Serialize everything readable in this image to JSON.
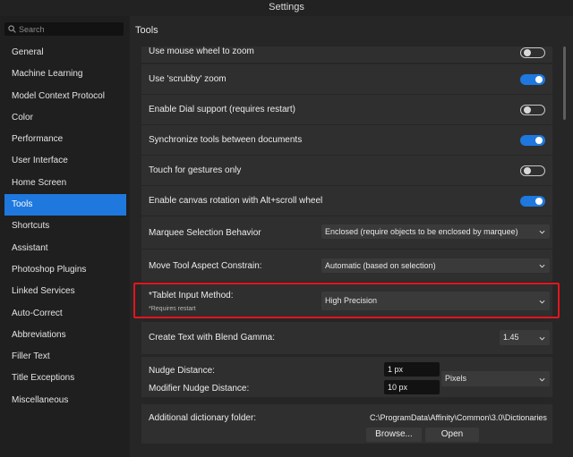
{
  "window": {
    "title": "Settings"
  },
  "search": {
    "placeholder": "Search"
  },
  "sidebar": {
    "items": [
      {
        "label": "General",
        "active": false
      },
      {
        "label": "Machine Learning",
        "active": false
      },
      {
        "label": "Model Context Protocol",
        "active": false
      },
      {
        "label": "Color",
        "active": false
      },
      {
        "label": "Performance",
        "active": false
      },
      {
        "label": "User Interface",
        "active": false
      },
      {
        "label": "Home Screen",
        "active": false
      },
      {
        "label": "Tools",
        "active": true
      },
      {
        "label": "Shortcuts",
        "active": false
      },
      {
        "label": "Assistant",
        "active": false
      },
      {
        "label": "Photoshop Plugins",
        "active": false
      },
      {
        "label": "Linked Services",
        "active": false
      },
      {
        "label": "Auto-Correct",
        "active": false
      },
      {
        "label": "Abbreviations",
        "active": false
      },
      {
        "label": "Filler Text",
        "active": false
      },
      {
        "label": "Title Exceptions",
        "active": false
      },
      {
        "label": "Miscellaneous",
        "active": false
      }
    ]
  },
  "main": {
    "title": "Tools",
    "toggles": [
      {
        "label": "Use mouse wheel to zoom",
        "on": false
      },
      {
        "label": "Use 'scrubby' zoom",
        "on": true
      },
      {
        "label": "Enable Dial support (requires restart)",
        "on": false
      },
      {
        "label": "Synchronize tools between documents",
        "on": true
      },
      {
        "label": "Touch for gestures only",
        "on": false
      },
      {
        "label": "Enable canvas rotation with Alt+scroll wheel",
        "on": true
      }
    ],
    "marquee": {
      "label": "Marquee Selection Behavior",
      "value": "Enclosed (require objects to be enclosed by marquee)"
    },
    "move_tool": {
      "label": "Move Tool Aspect Constrain:",
      "value": "Automatic (based on selection)"
    },
    "tablet": {
      "label": "*Tablet Input Method:",
      "note": "*Requires restart",
      "value": "High Precision"
    },
    "blend_gamma": {
      "label": "Create Text with Blend Gamma:",
      "value": "1.45"
    },
    "nudge": {
      "label": "Nudge Distance:",
      "value": "1 px",
      "modifier_label": "Modifier Nudge Distance:",
      "modifier_value": "10 px",
      "unit": "Pixels"
    },
    "dictionary": {
      "label": "Additional dictionary folder:",
      "path": "C:\\ProgramData\\Affinity\\Common\\3.0\\Dictionaries",
      "browse_label": "Browse...",
      "open_label": "Open"
    }
  },
  "colors": {
    "accent": "#1e78de",
    "highlight": "#e2161e"
  }
}
